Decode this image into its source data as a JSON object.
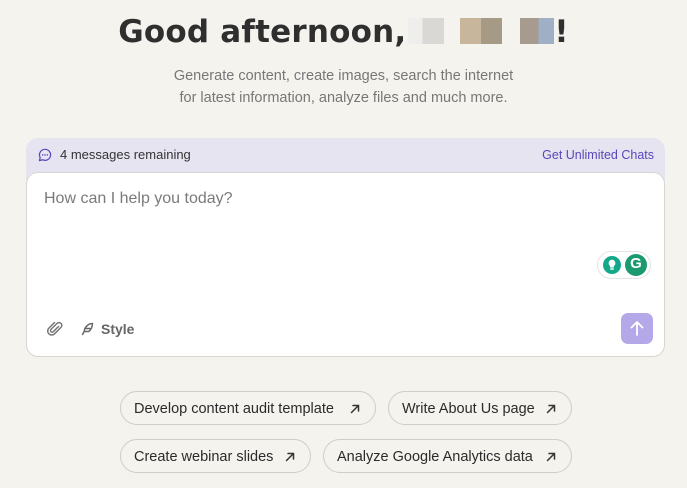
{
  "greeting": {
    "text": "Good afternoon,",
    "suffix": "!"
  },
  "subtitle": {
    "line1": "Generate content, create images, search the internet",
    "line2": "for latest information, analyze files and much more."
  },
  "chat": {
    "remaining": "4 messages remaining",
    "upgrade_link": "Get Unlimited Chats",
    "placeholder": "How can I help you today?",
    "style_label": "Style",
    "grammarly_letter": "G"
  },
  "suggestions": [
    {
      "label": "Develop content audit template"
    },
    {
      "label": "Write About Us page"
    },
    {
      "label": "Create webinar slides"
    },
    {
      "label": "Analyze Google Analytics data"
    }
  ],
  "colors": {
    "background": "#f4f3ee",
    "accent": "#5a46b8",
    "send_button": "#b5a8e8",
    "header_bar": "#e7e4f2"
  },
  "icons": [
    "chat-bubble-icon",
    "paperclip-icon",
    "feather-icon",
    "arrow-up-icon",
    "arrow-up-right-icon",
    "lightbulb-icon",
    "grammarly-icon"
  ]
}
